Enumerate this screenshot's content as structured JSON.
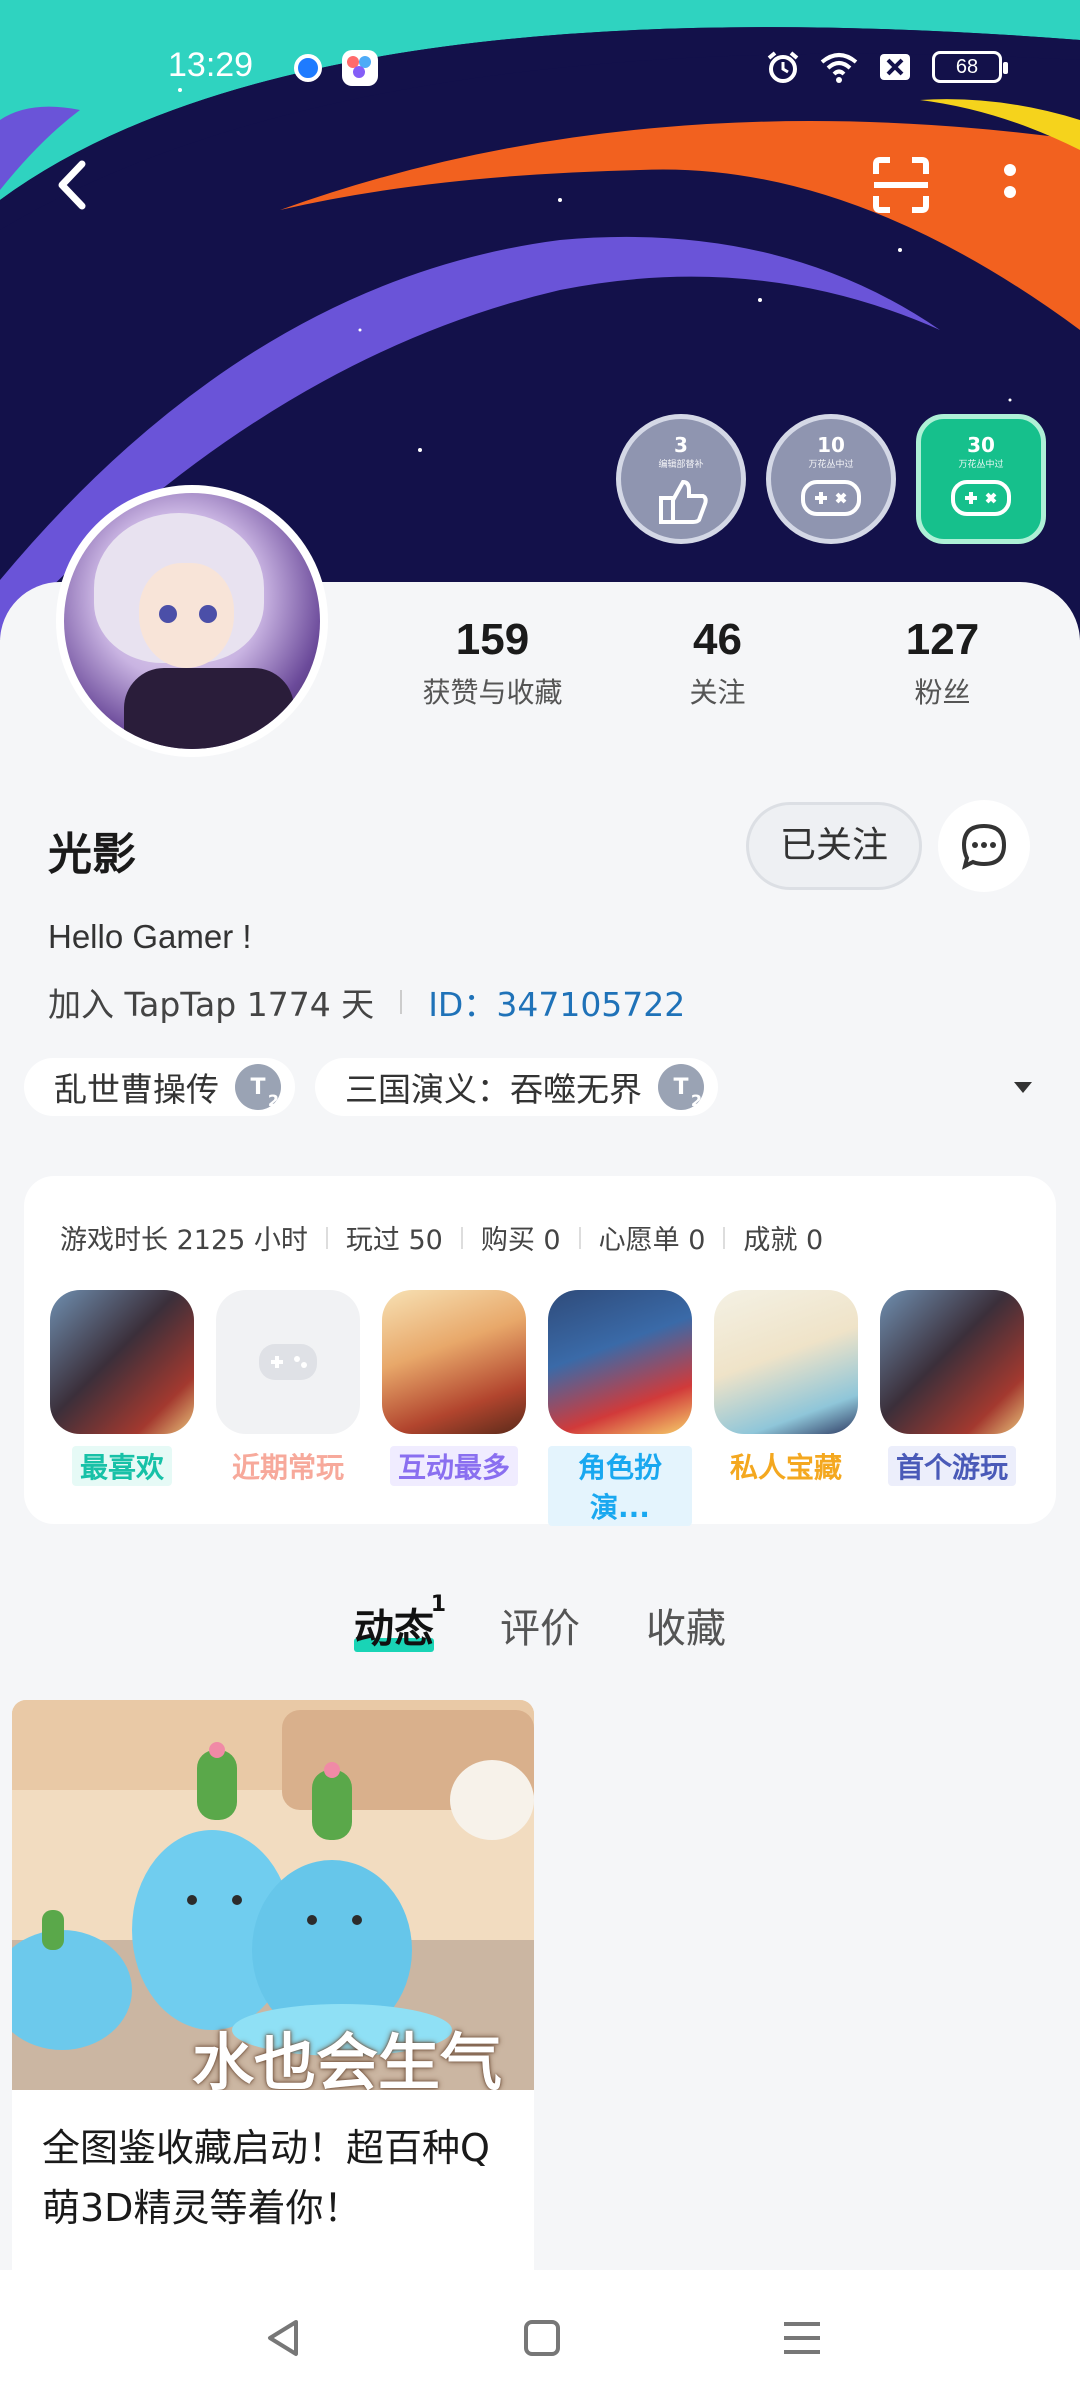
{
  "status_bar": {
    "time": "13:29",
    "battery": "68"
  },
  "badges": [
    {
      "num": "3",
      "sub": "编辑部替补"
    },
    {
      "num": "10",
      "sub": "万花丛中过"
    },
    {
      "num": "30",
      "sub": "万花丛中过"
    }
  ],
  "stats": [
    {
      "value": "159",
      "label": "获赞与收藏"
    },
    {
      "value": "46",
      "label": "关注"
    },
    {
      "value": "127",
      "label": "粉丝"
    }
  ],
  "profile": {
    "name": "光影",
    "follow_label": "已关注",
    "bio": "Hello Gamer !",
    "joined": "加入 TapTap 1774 天",
    "id_text": "ID：347105722"
  },
  "tags": [
    {
      "label": "乱世曹操传",
      "level": "2"
    },
    {
      "label": "三国演义：吞噬无界",
      "level": "2"
    }
  ],
  "game_stats": {
    "playtime": "游戏时长 2125 小时",
    "played": "玩过 50",
    "bought": "购买 0",
    "wishlist": "心愿单 0",
    "achievements": "成就 0"
  },
  "game_badges": [
    {
      "label": "最喜欢",
      "color": "#17c1a7"
    },
    {
      "label": "近期常玩",
      "color": "#f7a99b"
    },
    {
      "label": "互动最多",
      "color": "#8a6ff0"
    },
    {
      "label": "角色扮演...",
      "color": "#19a8f0"
    },
    {
      "label": "私人宝藏",
      "color": "#f4a820"
    },
    {
      "label": "首个游玩",
      "color": "#4a5ab8"
    }
  ],
  "tabs": [
    {
      "label": "动态",
      "count": "1"
    },
    {
      "label": "评价"
    },
    {
      "label": "收藏"
    }
  ],
  "post": {
    "title": "全图鉴收藏启动！超百种Q萌3D精灵等着你！",
    "image_caption": "水也会生气"
  },
  "colors": {
    "accent": "#19d4b6",
    "link": "#1f72b8",
    "banner": "#13114a"
  }
}
